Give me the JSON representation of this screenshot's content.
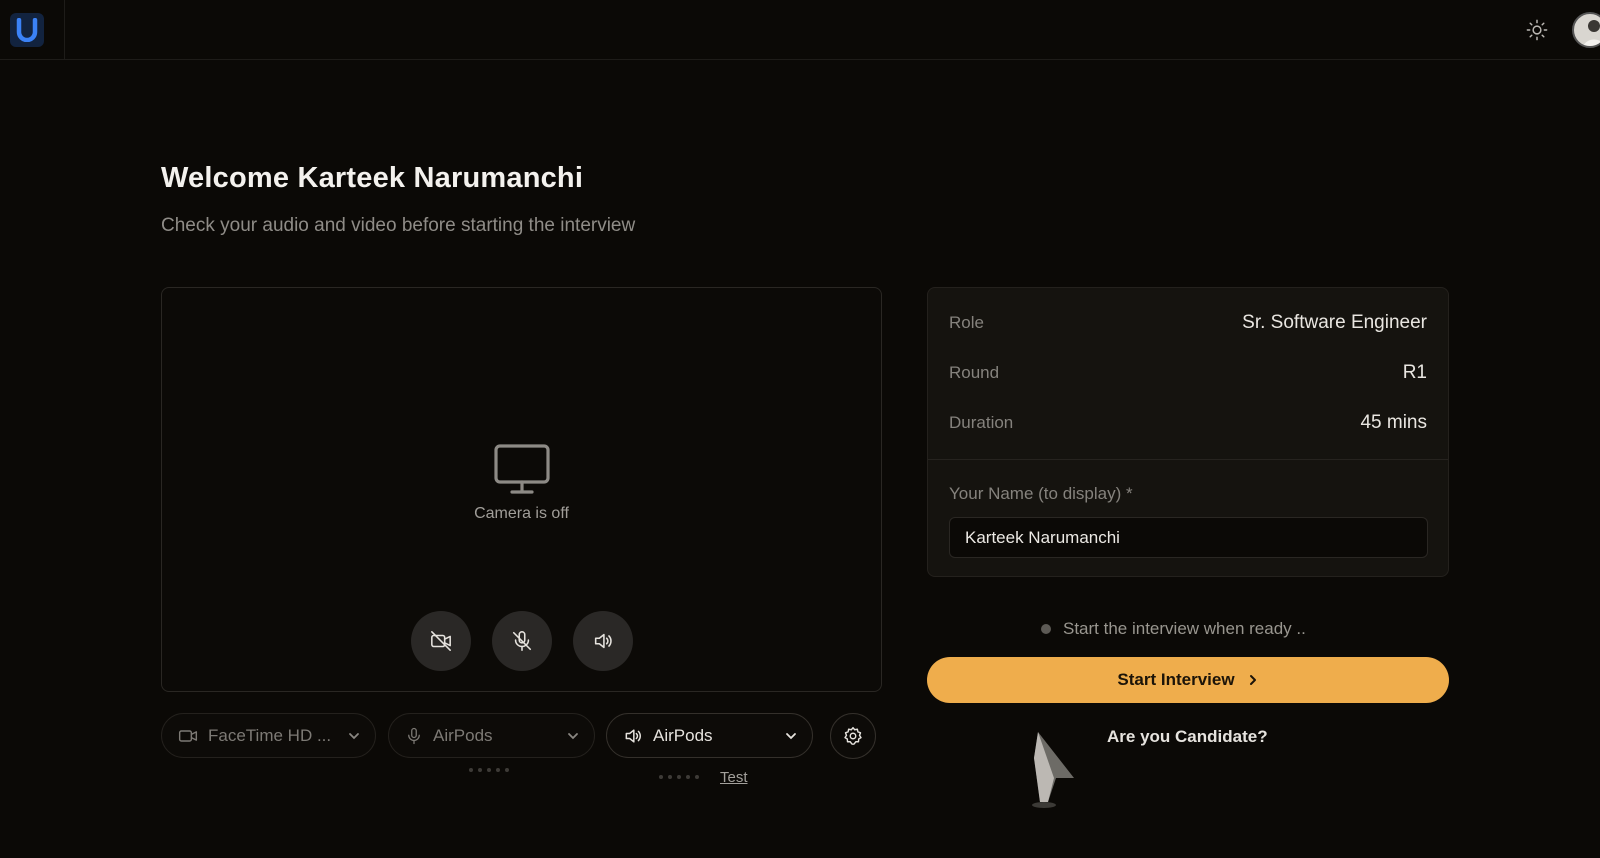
{
  "header": {
    "logo_letter": "U",
    "theme_toggle_icon": "sun-icon",
    "avatar_icon": "user-avatar"
  },
  "welcome": {
    "title": "Welcome Karteek Narumanchi",
    "subtitle": "Check your audio and video before starting the interview"
  },
  "preview": {
    "camera_status": "Camera is off",
    "icon": "monitor-icon",
    "controls": [
      {
        "name": "camera-off-toggle",
        "icon": "video-off-icon"
      },
      {
        "name": "mic-off-toggle",
        "icon": "mic-off-icon"
      },
      {
        "name": "speaker-toggle",
        "icon": "speaker-icon"
      }
    ]
  },
  "devices": {
    "camera": "FaceTime HD ...",
    "microphone": "AirPods",
    "speaker": "AirPods",
    "test_label": "Test"
  },
  "interview": {
    "role_label": "Role",
    "role_value": "Sr. Software Engineer",
    "round_label": "Round",
    "round_value": "R1",
    "duration_label": "Duration",
    "duration_value": "45 mins",
    "name_label": "Your Name (to display) *",
    "name_value": "Karteek Narumanchi"
  },
  "status": {
    "ready_text": "Start the interview when ready .."
  },
  "actions": {
    "start_label": "Start Interview",
    "candidate_question": "Are you Candidate?"
  },
  "colors": {
    "background": "#0b0906",
    "accent": "#efad4c",
    "logo_blue": "#3b82f6"
  }
}
